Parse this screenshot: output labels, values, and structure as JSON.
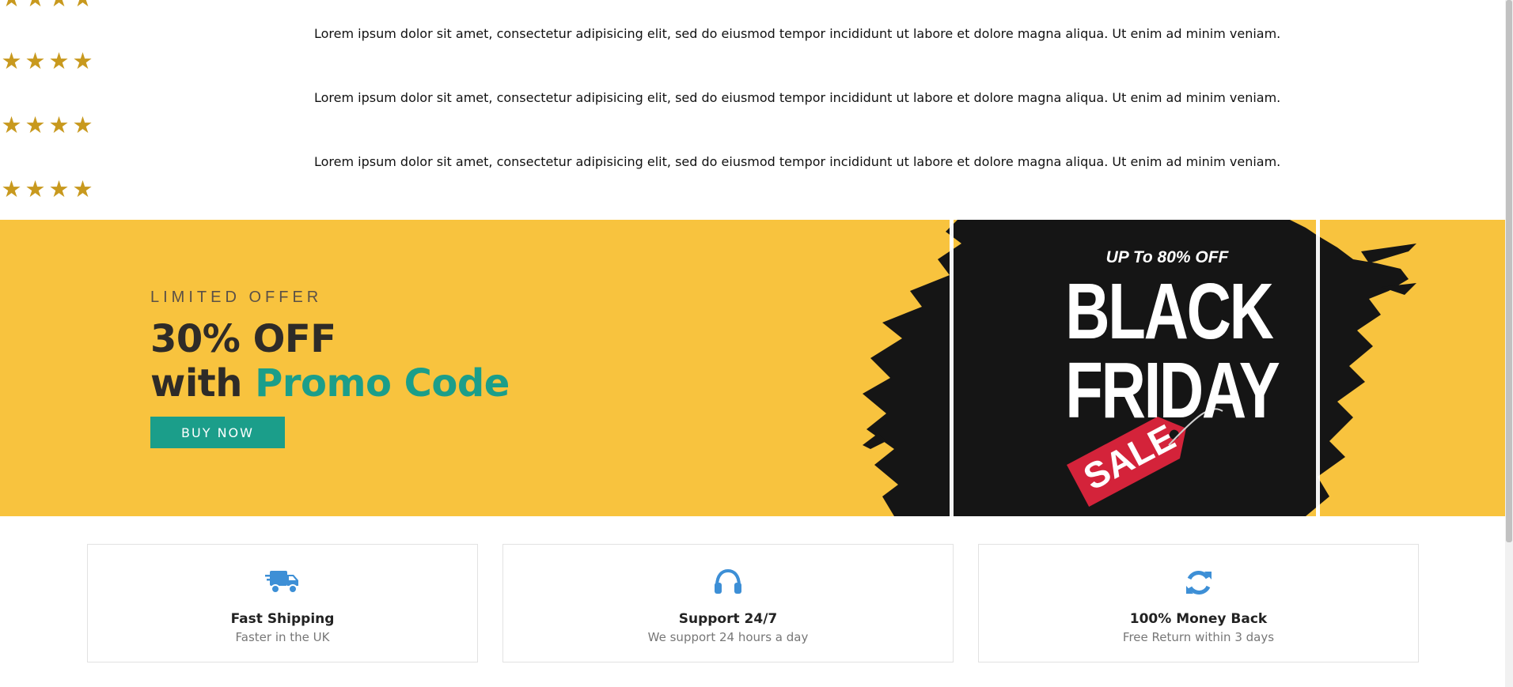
{
  "reviews": [
    {
      "rating_stars": 4,
      "text": ""
    },
    {
      "rating_stars": 4,
      "text": "Lorem ipsum dolor sit amet, consectetur adipisicing elit, sed do eiusmod tempor incididunt ut labore et dolore magna aliqua. Ut enim ad minim veniam."
    },
    {
      "rating_stars": 4,
      "text": "Lorem ipsum dolor sit amet, consectetur adipisicing elit, sed do eiusmod tempor incididunt ut labore et dolore magna aliqua. Ut enim ad minim veniam."
    },
    {
      "rating_stars": 4,
      "text": "Lorem ipsum dolor sit amet, consectetur adipisicing elit, sed do eiusmod tempor incididunt ut labore et dolore magna aliqua. Ut enim ad minim veniam."
    }
  ],
  "star_glyph": "★",
  "promo": {
    "kicker": "LIMITED OFFER",
    "headline_line1": "30% OFF",
    "headline_with": "with",
    "headline_accent": "Promo Code",
    "button_label": "BUY NOW",
    "banner": {
      "upto": "UP To 80% OFF",
      "word1": "BLACK",
      "word2": "FRIDAY",
      "tag": "SALE"
    }
  },
  "features": [
    {
      "icon": "truck-icon",
      "title": "Fast Shipping",
      "subtitle": "Faster in the UK"
    },
    {
      "icon": "headphones-icon",
      "title": "Support 24/7",
      "subtitle": "We support 24 hours a day"
    },
    {
      "icon": "refresh-icon",
      "title": "100% Money Back",
      "subtitle": "Free Return within 3 days"
    }
  ],
  "colors": {
    "star": "#c8991e",
    "promo_bg": "#f8c33e",
    "accent": "#1b9e8a",
    "headline": "#2e2b28",
    "feature_icon": "#3d8fd6",
    "sale_tag": "#d4233a",
    "brush": "#151515"
  }
}
